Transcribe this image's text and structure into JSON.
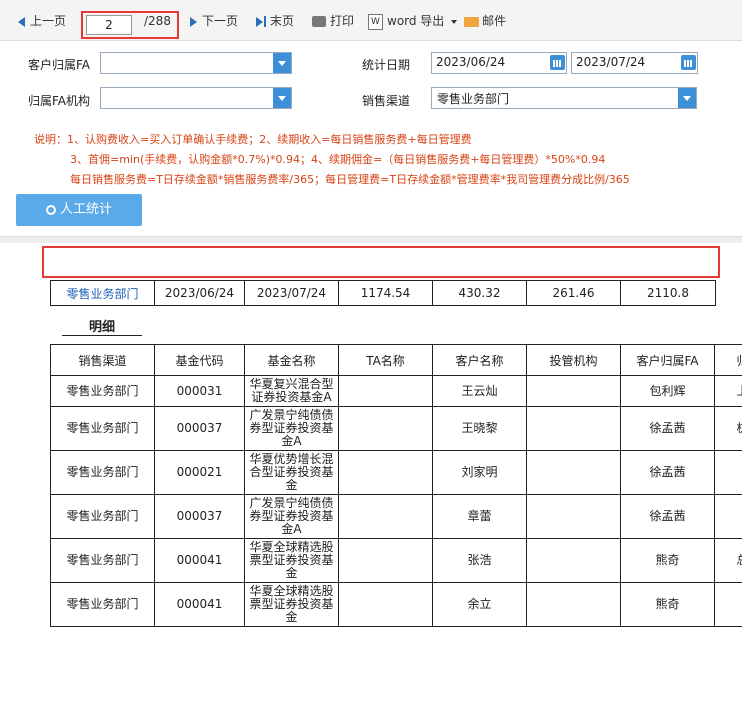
{
  "toolbar": {
    "prev_label": "上一页",
    "page_current": "2",
    "page_total": "/288",
    "next_label": "下一页",
    "last_label": "末页",
    "print_label": "打印",
    "word_label": "word 导出",
    "mail_label": "邮件"
  },
  "filters": {
    "fa_label": "客户归属FA",
    "fa_value": "",
    "org_label": "归属FA机构",
    "org_value": "",
    "date_label": "统计日期",
    "date_from": "2023/06/24",
    "date_to": "2023/07/24",
    "channel_label": "销售渠道",
    "channel_value": "零售业务部门"
  },
  "notes": {
    "line1": "说明：1、认购费收入=买入订单确认手续费；2、续期收入=每日销售服务费+每日管理费",
    "line2": "3、首佣=min(手续费，认购金额*0.7%)*0.94；4、续期佣金=（每日销售服务费+每日管理费）*50%*0.94",
    "line3": "每日销售服务费=T日存续金额*销售服务费率/365；每日管理费=T日存续金额*管理费率*我司管理费分成比例/365"
  },
  "manual_button": "人工统计",
  "summary": [
    "零售业务部门",
    "2023/06/24",
    "2023/07/24",
    "1174.54",
    "430.32",
    "261.46",
    "2110.8"
  ],
  "detail_title": "明细",
  "detail_headers": [
    "销售渠道",
    "基金代码",
    "基金名称",
    "TA名称",
    "客户名称",
    "投管机构",
    "客户归属FA",
    "归"
  ],
  "detail_rows": [
    [
      "零售业务部门",
      "000031",
      "华夏复兴混合型证券投资基金A",
      "",
      "王云灿",
      "",
      "包利辉",
      "上"
    ],
    [
      "零售业务部门",
      "000037",
      "广发景宁纯债债券型证券投资基金A",
      "",
      "王晓黎",
      "",
      "徐孟茜",
      "杭"
    ],
    [
      "零售业务部门",
      "000021",
      "华夏优势增长混合型证券投资基金",
      "",
      "刘家明",
      "",
      "徐孟茜",
      ""
    ],
    [
      "零售业务部门",
      "000037",
      "广发景宁纯债债券型证券投资基金A",
      "",
      "章蕾",
      "",
      "徐孟茜",
      ""
    ],
    [
      "零售业务部门",
      "000041",
      "华夏全球精选股票型证券投资基金",
      "",
      "张浩",
      "",
      "熊奇",
      "总"
    ],
    [
      "零售业务部门",
      "000041",
      "华夏全球精选股票型证券投资基金",
      "",
      "余立",
      "",
      "熊奇",
      ""
    ]
  ]
}
